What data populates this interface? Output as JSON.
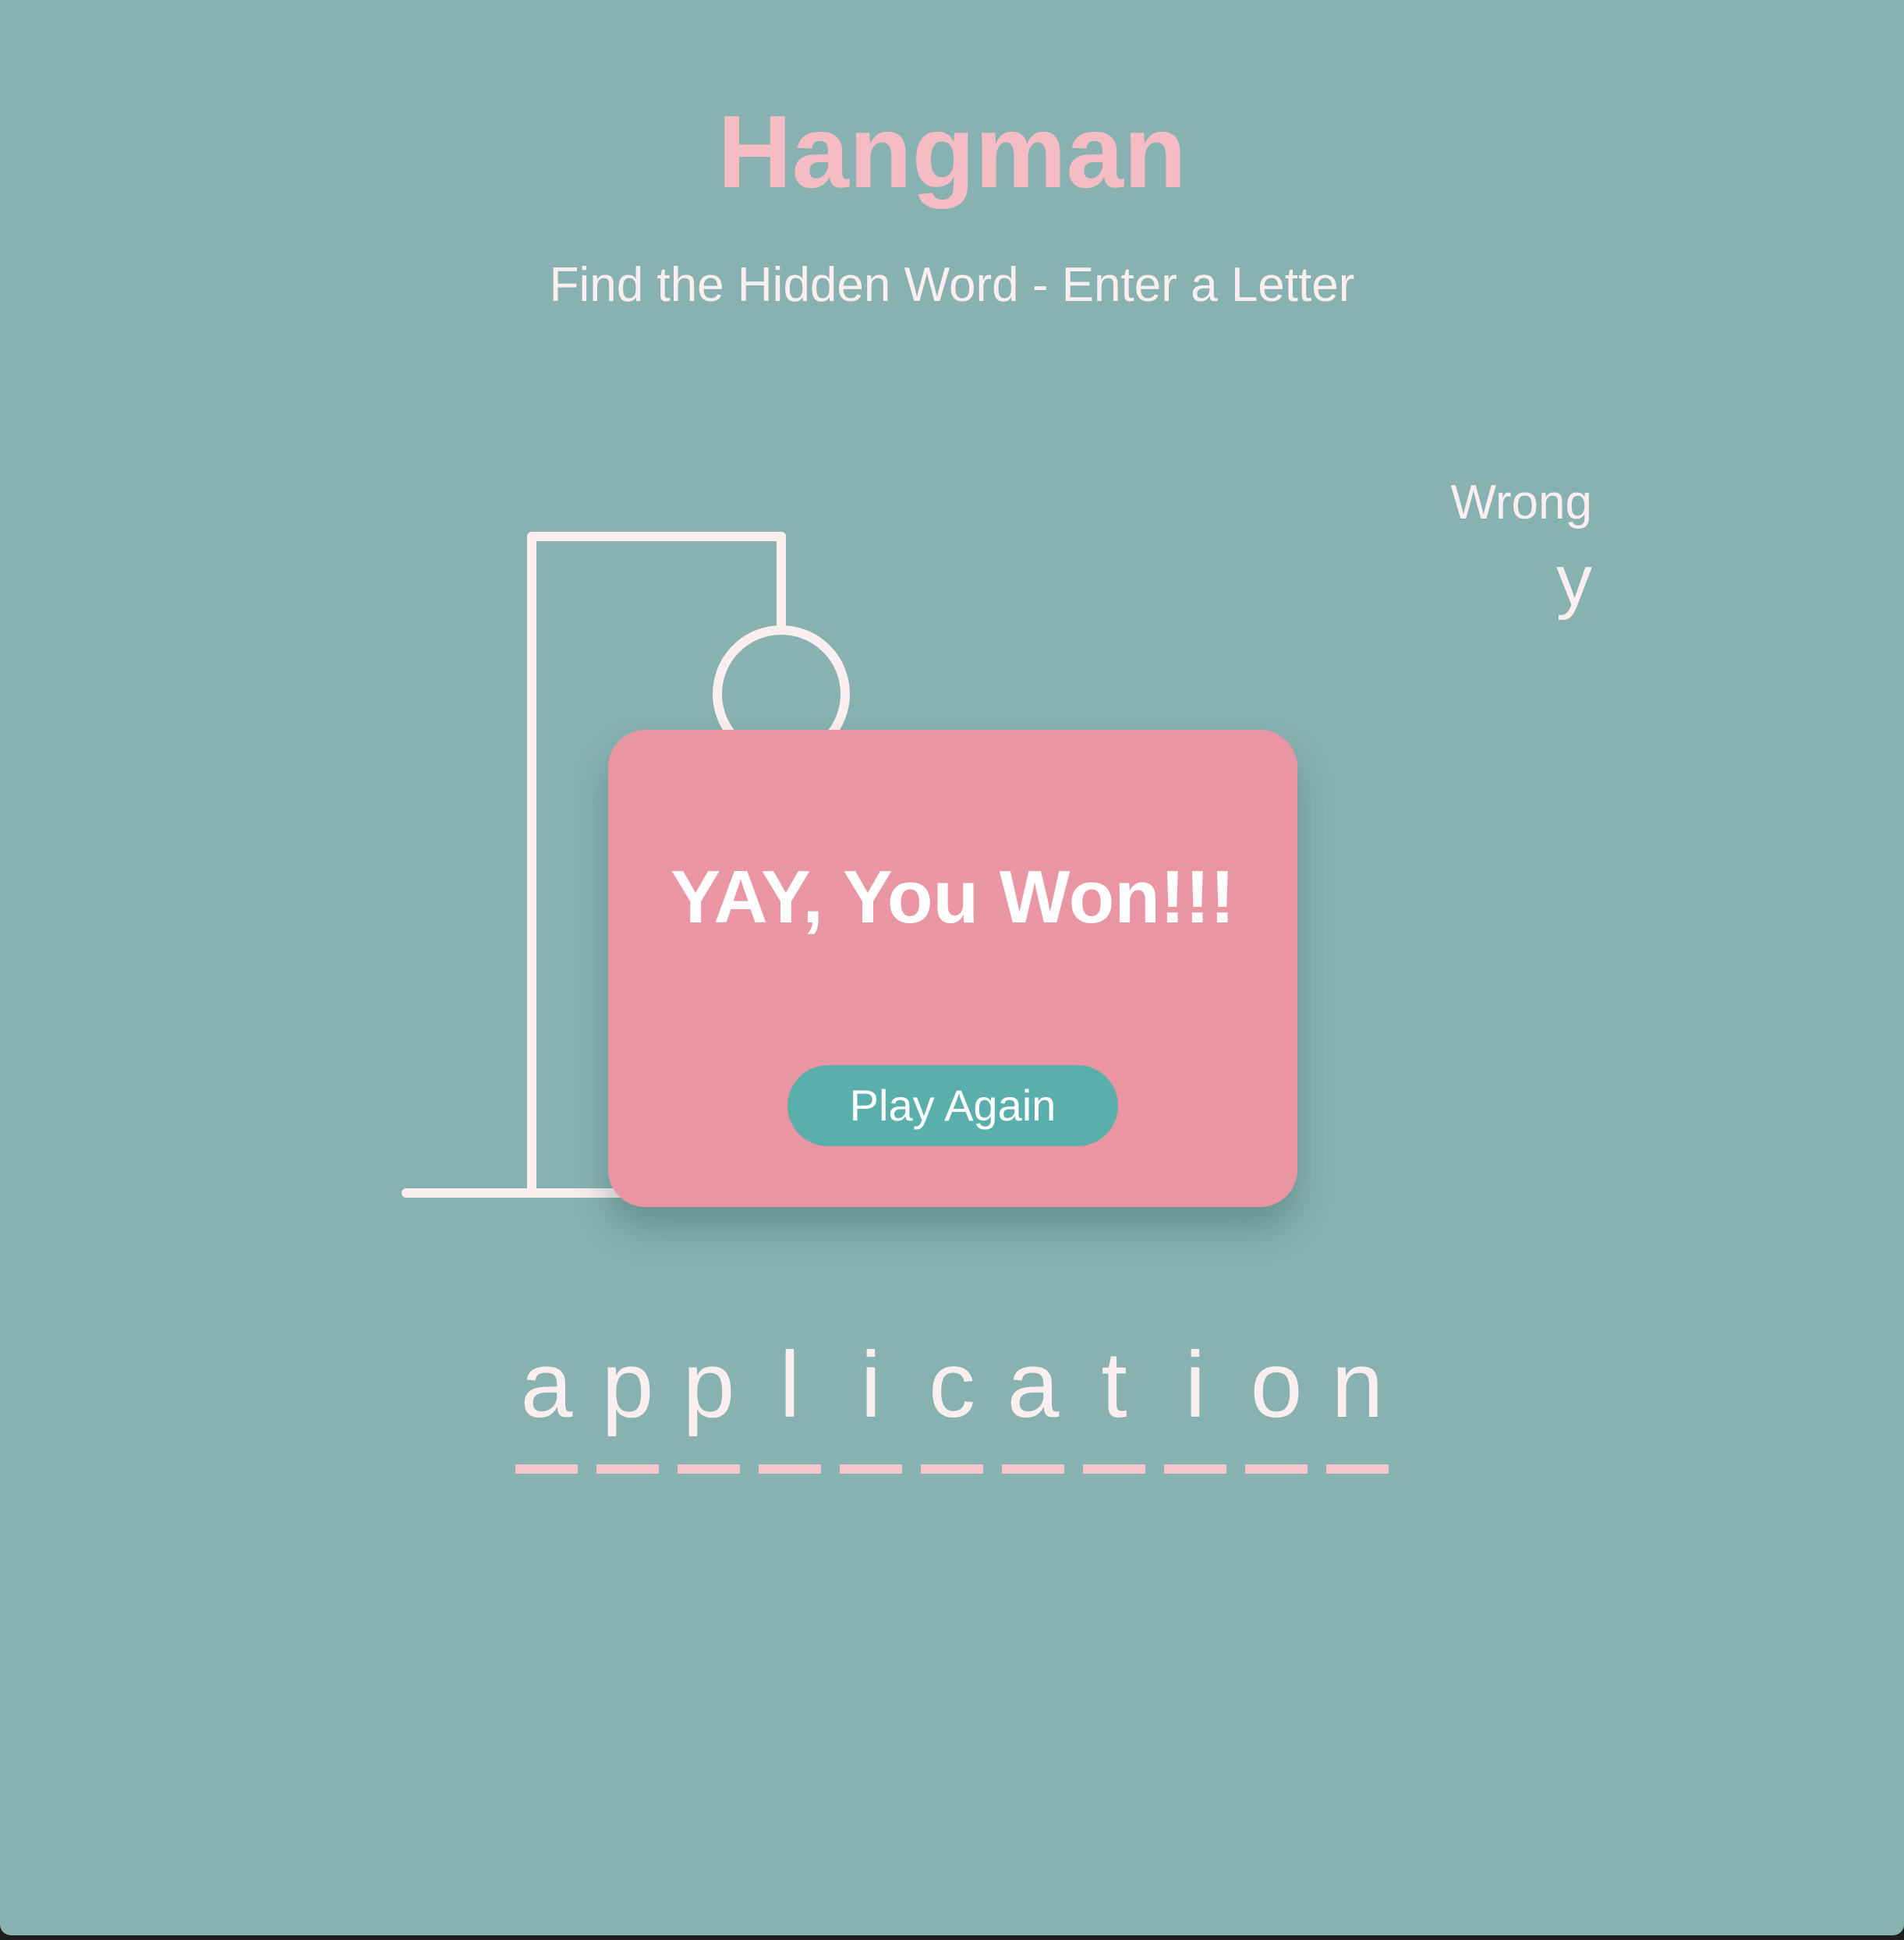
{
  "header": {
    "title": "Hangman",
    "subtitle": "Find the Hidden Word - Enter a Letter"
  },
  "wrong_letters": {
    "label": "Wrong",
    "letters": [
      "y"
    ]
  },
  "word": {
    "letters": [
      "a",
      "p",
      "p",
      "l",
      "i",
      "c",
      "a",
      "t",
      "i",
      "o",
      "n"
    ]
  },
  "popup": {
    "message": "YAY, You Won!!!",
    "button_label": "Play Again"
  },
  "colors": {
    "background": "#88b2b1",
    "title": "#f5bcc4",
    "popup": "#ea96a2",
    "button": "#5aafac",
    "figure_stroke": "#faeeee"
  }
}
